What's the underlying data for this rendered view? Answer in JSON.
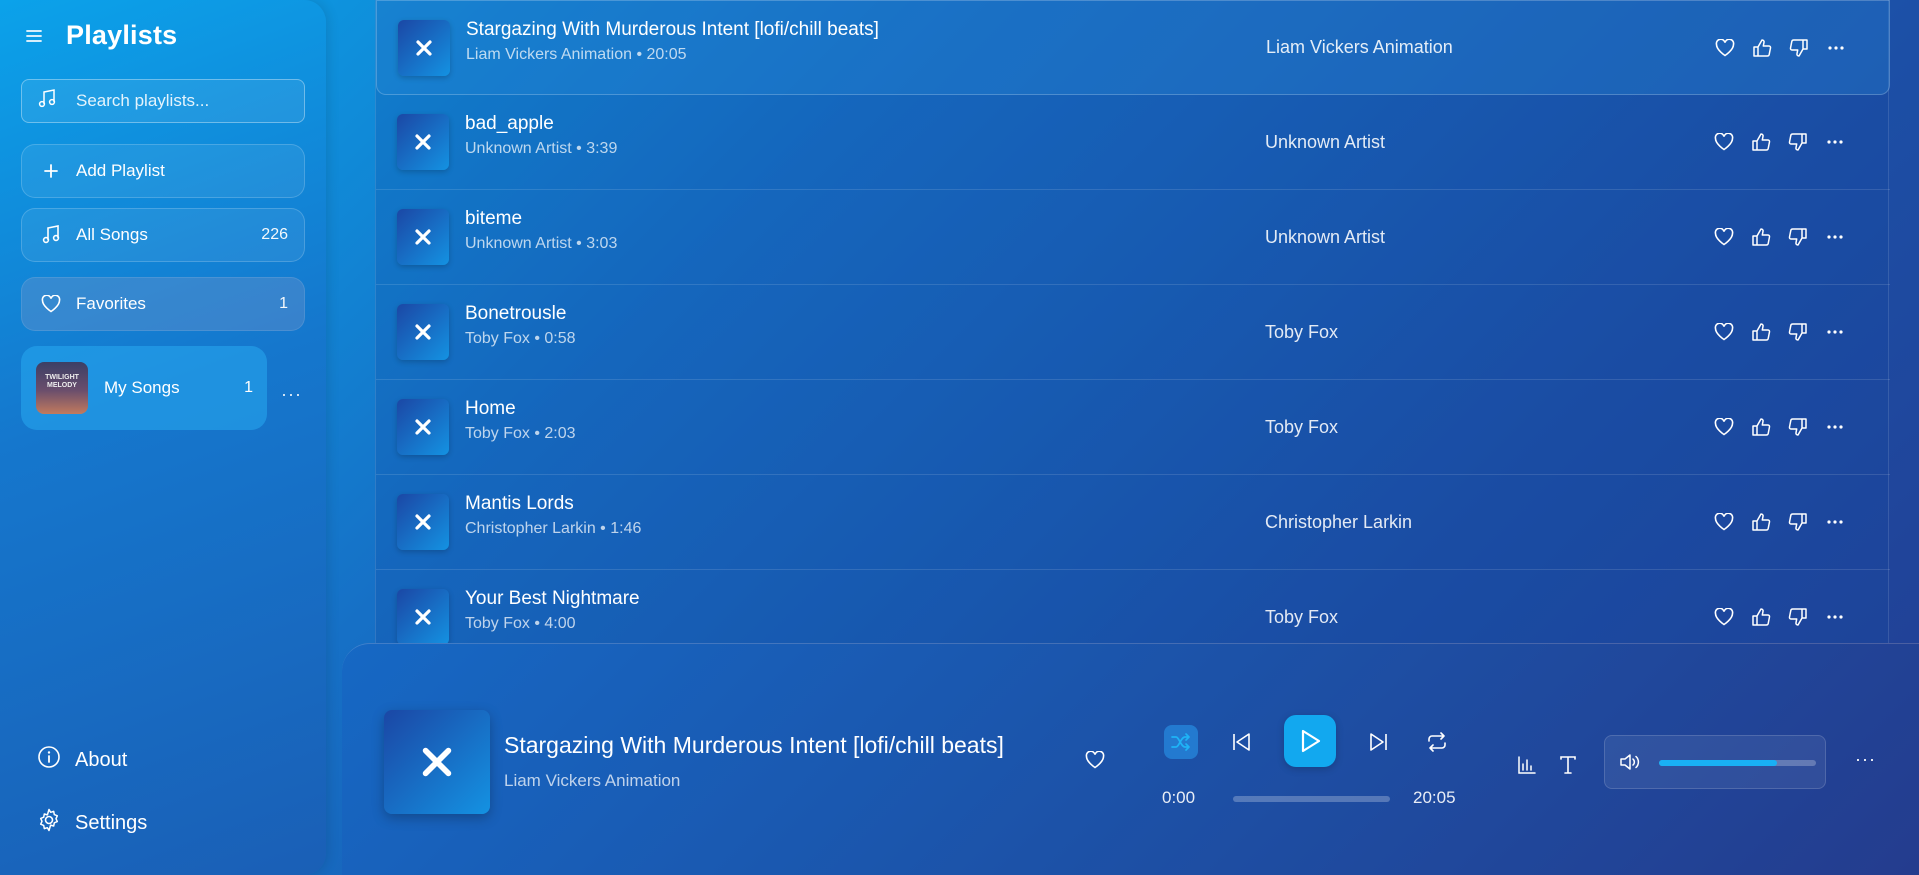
{
  "sidebar": {
    "title": "Playlists",
    "search_placeholder": "Search playlists...",
    "add_label": "Add Playlist",
    "all_songs": {
      "label": "All Songs",
      "count": "226"
    },
    "favorites": {
      "label": "Favorites",
      "count": "1"
    },
    "my_songs": {
      "label": "My Songs",
      "count": "1",
      "thumb_text": "TWILIGHT MELODY"
    },
    "about_label": "About",
    "settings_label": "Settings"
  },
  "songs": [
    {
      "title": "Stargazing With Murderous Intent [lofi/chill beats]",
      "sub": "Liam Vickers Animation • 20:05",
      "artist": "Liam Vickers Animation"
    },
    {
      "title": "bad_apple",
      "sub": "Unknown Artist • 3:39",
      "artist": "Unknown Artist"
    },
    {
      "title": "biteme",
      "sub": "Unknown Artist • 3:03",
      "artist": "Unknown Artist"
    },
    {
      "title": "Bonetrousle",
      "sub": "Toby Fox • 0:58",
      "artist": "Toby Fox"
    },
    {
      "title": "Home",
      "sub": "Toby Fox • 2:03",
      "artist": "Toby Fox"
    },
    {
      "title": "Mantis Lords",
      "sub": "Christopher Larkin • 1:46",
      "artist": "Christopher Larkin"
    },
    {
      "title": "Your Best Nightmare",
      "sub": "Toby Fox • 4:00",
      "artist": "Toby Fox"
    }
  ],
  "player": {
    "title": "Stargazing With Murderous Intent [lofi/chill beats]",
    "artist": "Liam Vickers Animation",
    "current_time": "0:00",
    "total_time": "20:05",
    "progress_fraction": 0.0,
    "volume_fraction": 0.75
  },
  "icons": {
    "menu": "hamburger-icon",
    "search": "music-note-icon",
    "add": "plus-icon",
    "heart": "heart-icon",
    "like": "thumbs-up-icon",
    "dislike": "thumbs-down-icon",
    "more": "more-horizontal-icon",
    "about": "info-icon",
    "settings": "gear-icon"
  },
  "colors": {
    "accent": "#12a8ef"
  }
}
